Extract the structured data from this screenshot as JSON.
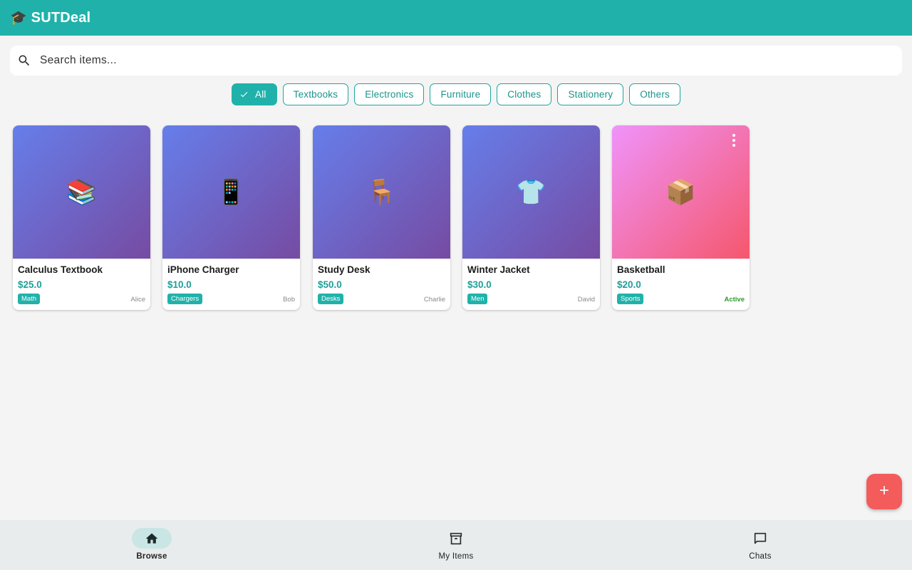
{
  "app": {
    "logo_icon": "🎓",
    "title": "SUTDeal",
    "accent": "#20b2aa"
  },
  "search": {
    "placeholder": "Search items...",
    "value": "",
    "icon": "search-icon"
  },
  "categories": [
    {
      "label": "All",
      "selected": true
    },
    {
      "label": "Textbooks",
      "selected": false
    },
    {
      "label": "Electronics",
      "selected": false
    },
    {
      "label": "Furniture",
      "selected": false
    },
    {
      "label": "Clothes",
      "selected": false
    },
    {
      "label": "Stationery",
      "selected": false
    },
    {
      "label": "Others",
      "selected": false
    }
  ],
  "items": [
    {
      "emoji": "📚",
      "name": "Calculus Textbook",
      "price": "$25.0",
      "tag": "Math",
      "owner": "Alice"
    },
    {
      "emoji": "📱",
      "name": "iPhone Charger",
      "price": "$10.0",
      "tag": "Chargers",
      "owner": "Bob"
    },
    {
      "emoji": "🪑",
      "name": "Study Desk",
      "price": "$50.0",
      "tag": "Desks",
      "owner": "Charlie"
    },
    {
      "emoji": "👕",
      "name": "Winter Jacket",
      "price": "$30.0",
      "tag": "Men",
      "owner": "David"
    },
    {
      "emoji": "📦",
      "name": "Basketball",
      "price": "$20.0",
      "tag": "Sports",
      "status": "Active"
    }
  ],
  "fab": {
    "icon": "plus-icon",
    "color": "#f45b5b"
  },
  "nav": [
    {
      "label": "Browse",
      "icon": "home-icon",
      "active": true
    },
    {
      "label": "My Items",
      "icon": "archive-icon",
      "active": false
    },
    {
      "label": "Chats",
      "icon": "chat-icon",
      "active": false
    }
  ]
}
